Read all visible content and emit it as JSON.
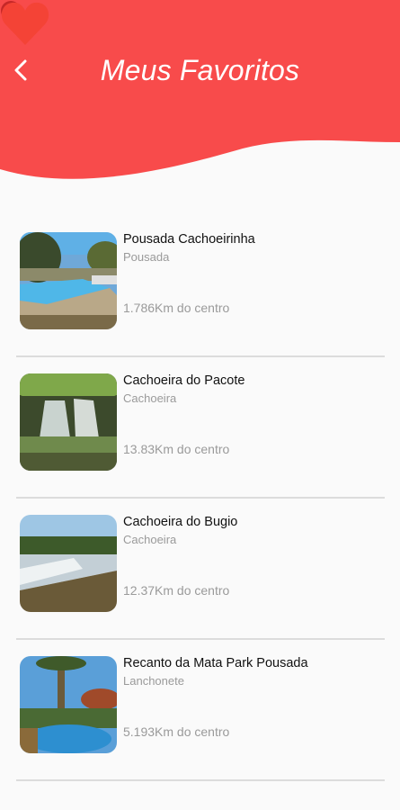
{
  "header": {
    "title": "Meus Favoritos",
    "back_icon": "chevron-left-icon",
    "favorite_icon": "heart-icon",
    "color": "#f84b4b"
  },
  "favorites": [
    {
      "name": "Pousada Cachoeirinha",
      "category": "Pousada",
      "distance": "1.786Km do centro",
      "image": "pool-photo"
    },
    {
      "name": "Cachoeira do Pacote",
      "category": "Cachoeira",
      "distance": "13.83Km do centro",
      "image": "waterfall-photo"
    },
    {
      "name": "Cachoeira do Bugio",
      "category": "Cachoeira",
      "distance": "12.37Km do centro",
      "image": "cascade-photo"
    },
    {
      "name": "Recanto da Mata Park Pousada",
      "category": "Lanchonete",
      "distance": "5.193Km do centro",
      "image": "resort-photo"
    }
  ]
}
